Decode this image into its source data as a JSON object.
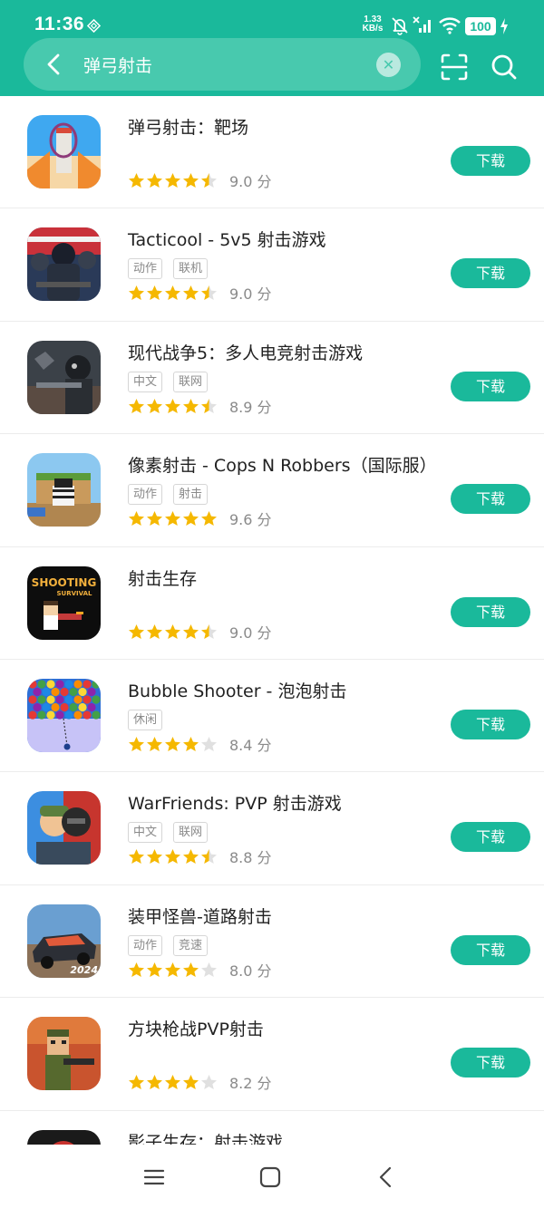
{
  "status": {
    "time": "11:36",
    "net_speed_value": "1.33",
    "net_speed_unit": "KB/s",
    "battery": "100"
  },
  "search": {
    "query": "弹弓射击"
  },
  "colors": {
    "accent": "#1ab99b",
    "star": "#f5b800",
    "star_empty": "#e0e0e0"
  },
  "apps": [
    {
      "name": "弹弓射击：靶场",
      "tags": [],
      "rating": 4.5,
      "score": "9.0 分",
      "button": "下载"
    },
    {
      "name": "Tacticool - 5v5 射击游戏",
      "tags": [
        "动作",
        "联机"
      ],
      "rating": 4.5,
      "score": "9.0 分",
      "button": "下载"
    },
    {
      "name": "现代战争5：多人电竞射击游戏",
      "tags": [
        "中文",
        "联网"
      ],
      "rating": 4.5,
      "score": "8.9 分",
      "button": "下载"
    },
    {
      "name": "像素射击 - Cops N Robbers（国际服）",
      "tags": [
        "动作",
        "射击"
      ],
      "rating": 5,
      "score": "9.6 分",
      "button": "下载"
    },
    {
      "name": "射击生存",
      "tags": [],
      "rating": 4.5,
      "score": "9.0 分",
      "button": "下载",
      "icon_text_1": "SHOOTING",
      "icon_text_2": "SURVIVAL"
    },
    {
      "name": "Bubble Shooter - 泡泡射击",
      "tags": [
        "休闲"
      ],
      "rating": 4,
      "score": "8.4 分",
      "button": "下载"
    },
    {
      "name": "WarFriends: PVP 射击游戏",
      "tags": [
        "中文",
        "联网"
      ],
      "rating": 4.5,
      "score": "8.8 分",
      "button": "下载"
    },
    {
      "name": "装甲怪兽-道路射击",
      "tags": [
        "动作",
        "竞速"
      ],
      "rating": 4,
      "score": "8.0 分",
      "button": "下载",
      "icon_text_1": "2024"
    },
    {
      "name": "方块枪战PVP射击",
      "tags": [],
      "rating": 4,
      "score": "8.2 分",
      "button": "下载"
    },
    {
      "name": "影子生存：射击游戏",
      "tags": [],
      "rating": 0,
      "score": "",
      "button": ""
    }
  ]
}
